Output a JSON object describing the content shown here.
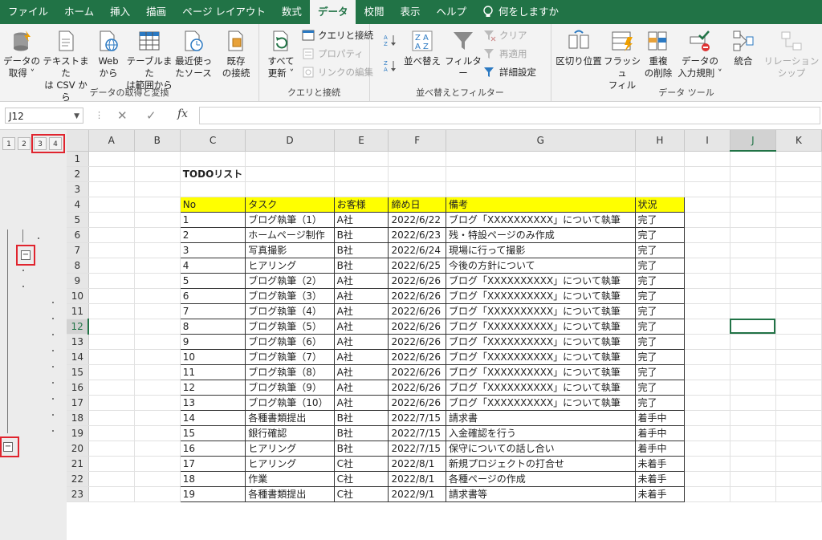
{
  "tabs": [
    "ファイル",
    "ホーム",
    "挿入",
    "描画",
    "ページ レイアウト",
    "数式",
    "データ",
    "校閲",
    "表示",
    "ヘルプ"
  ],
  "active_tab": "データ",
  "search_label": "何をしますか",
  "ribbon": {
    "get_transform": {
      "label": "データの取得と変換",
      "buttons": [
        {
          "l1": "データの",
          "l2": "取得 ˅"
        },
        {
          "l1": "テキストまた",
          "l2": "は CSV から"
        },
        {
          "l1": "Web",
          "l2": "から"
        },
        {
          "l1": "テーブルまた",
          "l2": "は範囲から"
        },
        {
          "l1": "最近使っ",
          "l2": "たソース"
        },
        {
          "l1": "既存",
          "l2": "の接続"
        }
      ]
    },
    "queries": {
      "label": "クエリと接続",
      "refresh": {
        "l1": "すべて",
        "l2": "更新 ˅"
      },
      "small": [
        "クエリと接続",
        "プロパティ",
        "リンクの編集"
      ]
    },
    "sort_filter": {
      "label": "並べ替えとフィルター",
      "sort": "並べ替え",
      "filter": "フィルター",
      "small": [
        "クリア",
        "再適用",
        "詳細設定"
      ]
    },
    "data_tools": {
      "label": "データ ツール",
      "buttons": [
        {
          "l1": "区切り位置",
          "l2": ""
        },
        {
          "l1": "フラッシュ",
          "l2": "フィル"
        },
        {
          "l1": "重複",
          "l2": "の削除"
        },
        {
          "l1": "データの",
          "l2": "入力規則 ˅"
        },
        {
          "l1": "統合",
          "l2": ""
        },
        {
          "l1": "リレーションシップ",
          "l2": ""
        }
      ]
    }
  },
  "formula_bar": {
    "name_box": "J12",
    "fx": "fx",
    "value": ""
  },
  "outline_levels": [
    "1",
    "2",
    "3",
    "4"
  ],
  "columns": [
    "A",
    "B",
    "C",
    "D",
    "E",
    "F",
    "G",
    "H",
    "I",
    "J",
    "K"
  ],
  "selected_cell": {
    "col": "J",
    "row": "12"
  },
  "title": "TODOリスト",
  "table_header": [
    "No",
    "タスク",
    "お客様",
    "締め日",
    "備考",
    "状況"
  ],
  "rows": [
    [
      "1",
      "ブログ執筆（1）",
      "A社",
      "2022/6/22",
      "ブログ「XXXXXXXXXX」について執筆",
      "完了"
    ],
    [
      "2",
      "ホームページ制作",
      "B社",
      "2022/6/23",
      "残・特設ページのみ作成",
      "完了"
    ],
    [
      "3",
      "写真撮影",
      "B社",
      "2022/6/24",
      "現場に行って撮影",
      "完了"
    ],
    [
      "4",
      "ヒアリング",
      "B社",
      "2022/6/25",
      "今後の方針について",
      "完了"
    ],
    [
      "5",
      "ブログ執筆（2）",
      "A社",
      "2022/6/26",
      "ブログ「XXXXXXXXXX」について執筆",
      "完了"
    ],
    [
      "6",
      "ブログ執筆（3）",
      "A社",
      "2022/6/26",
      "ブログ「XXXXXXXXXX」について執筆",
      "完了"
    ],
    [
      "7",
      "ブログ執筆（4）",
      "A社",
      "2022/6/26",
      "ブログ「XXXXXXXXXX」について執筆",
      "完了"
    ],
    [
      "8",
      "ブログ執筆（5）",
      "A社",
      "2022/6/26",
      "ブログ「XXXXXXXXXX」について執筆",
      "完了"
    ],
    [
      "9",
      "ブログ執筆（6）",
      "A社",
      "2022/6/26",
      "ブログ「XXXXXXXXXX」について執筆",
      "完了"
    ],
    [
      "10",
      "ブログ執筆（7）",
      "A社",
      "2022/6/26",
      "ブログ「XXXXXXXXXX」について執筆",
      "完了"
    ],
    [
      "11",
      "ブログ執筆（8）",
      "A社",
      "2022/6/26",
      "ブログ「XXXXXXXXXX」について執筆",
      "完了"
    ],
    [
      "12",
      "ブログ執筆（9）",
      "A社",
      "2022/6/26",
      "ブログ「XXXXXXXXXX」について執筆",
      "完了"
    ],
    [
      "13",
      "ブログ執筆（10）",
      "A社",
      "2022/6/26",
      "ブログ「XXXXXXXXXX」について執筆",
      "完了"
    ],
    [
      "14",
      "各種書類提出",
      "B社",
      "2022/7/15",
      "請求書",
      "着手中"
    ],
    [
      "15",
      "銀行確認",
      "B社",
      "2022/7/15",
      "入金確認を行う",
      "着手中"
    ],
    [
      "16",
      "ヒアリング",
      "B社",
      "2022/7/15",
      "保守についての話し合い",
      "着手中"
    ],
    [
      "17",
      "ヒアリング",
      "C社",
      "2022/8/1",
      "新規プロジェクトの打合せ",
      "未着手"
    ],
    [
      "18",
      "作業",
      "C社",
      "2022/8/1",
      "各種ページの作成",
      "未着手"
    ],
    [
      "19",
      "各種書類提出",
      "C社",
      "2022/9/1",
      "請求書等",
      "未着手"
    ]
  ],
  "colors": {
    "excel_green": "#217346",
    "header_yellow": "#ffff00",
    "highlight_red": "#e0242e"
  }
}
